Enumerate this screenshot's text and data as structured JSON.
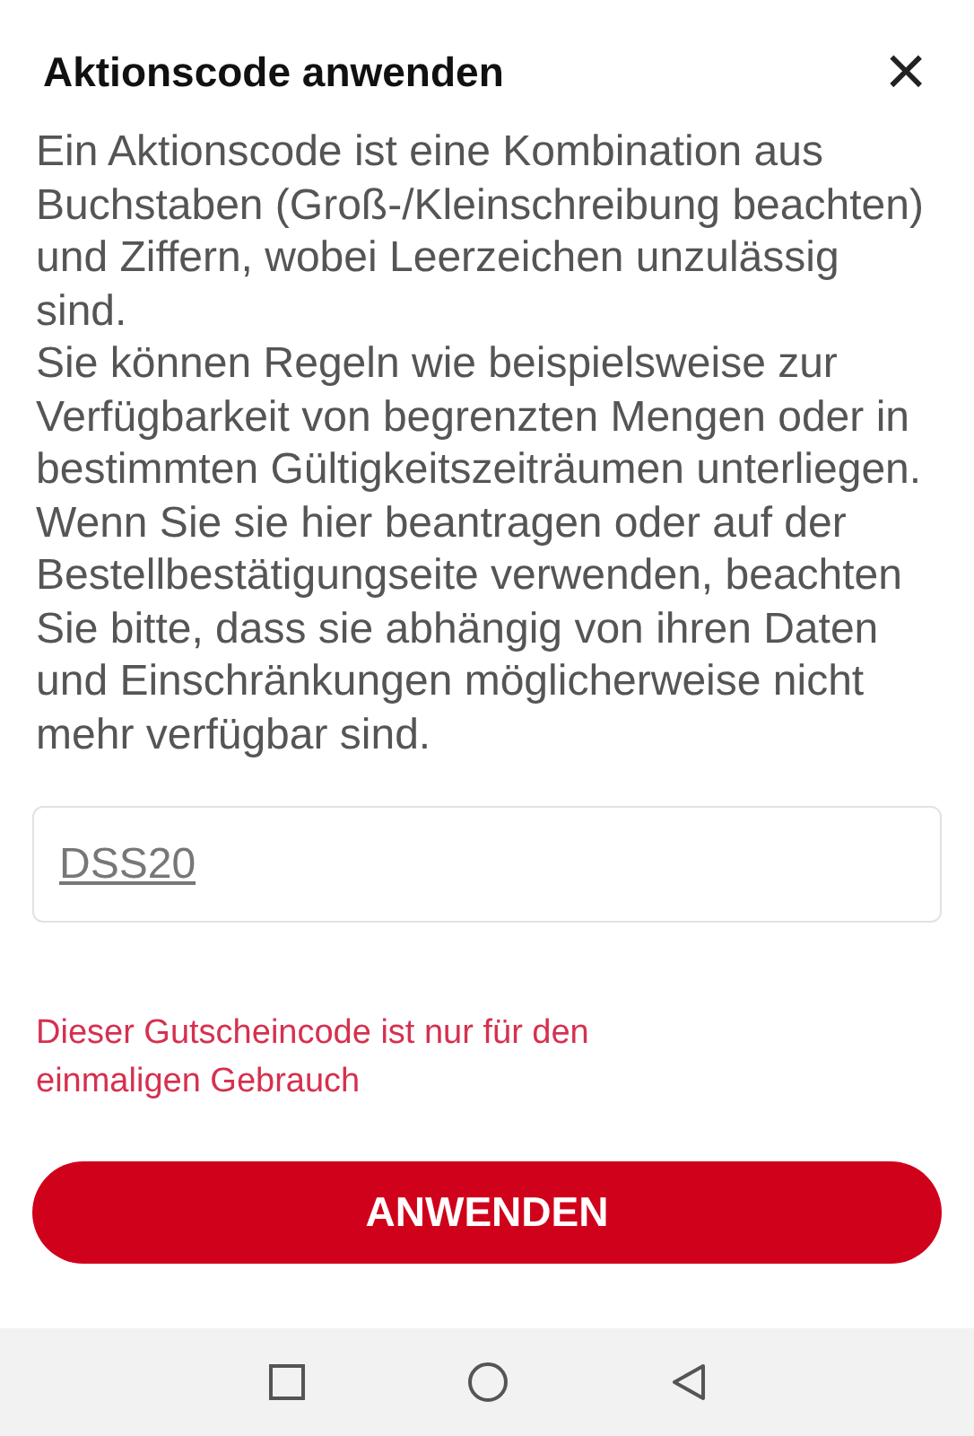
{
  "dialog": {
    "title": "Aktionscode anwenden",
    "close": "×"
  },
  "description": [
    "Ein Aktionscode ist eine Kombination aus Buchstaben (Groß-/Kleinschreibung beachten) und Ziffern, wobei Leerzeichen unzulässig sind.",
    "Sie können Regeln wie beispielsweise zur Verfügbarkeit von begrenzten Mengen oder in bestimmten Gültigkeitszeiträumen unterliegen. Wenn Sie sie hier beantragen oder auf der Bestellbestätigungseite verwenden, beachten Sie bitte, dass sie abhängig von ihren Daten und Einschränkungen möglicherweise nicht mehr verfügbar sind."
  ],
  "code_field": {
    "value": "DSS20"
  },
  "error": "Dieser Gutscheincode ist nur für den einmaligen Gebrauch",
  "apply_button": "ANWENDEN",
  "nav_bar": [
    {
      "kind": "recent"
    },
    {
      "kind": "home"
    },
    {
      "kind": "back"
    }
  ]
}
